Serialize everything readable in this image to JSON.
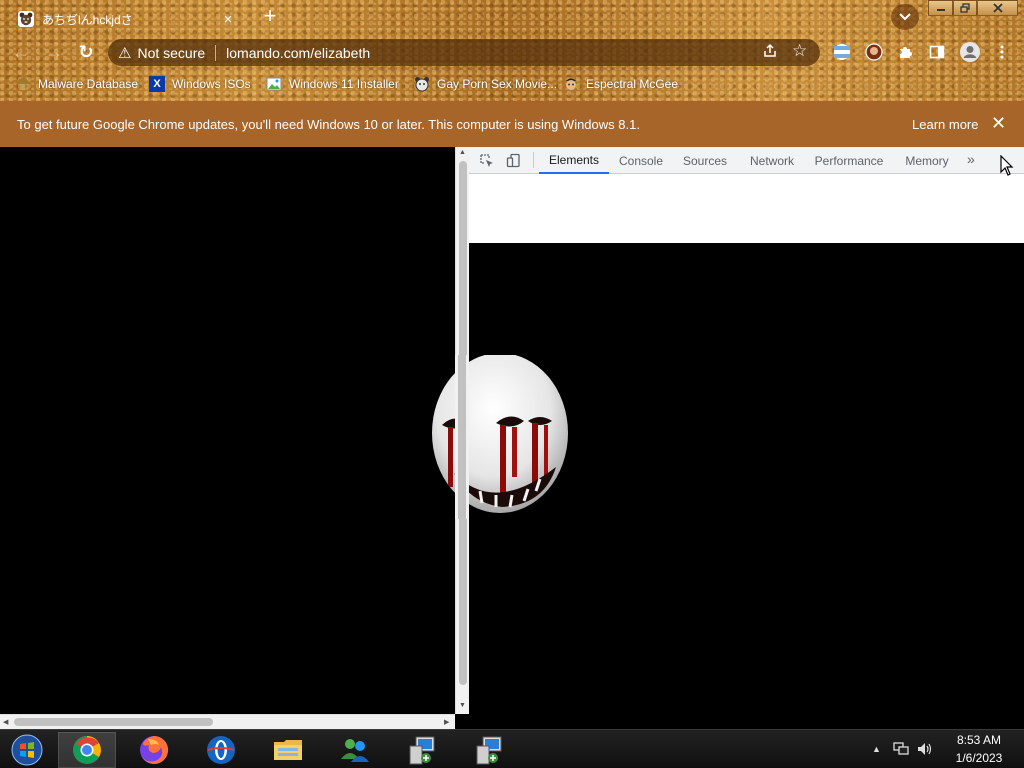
{
  "browser": {
    "tab": {
      "favicon": "bear-face-icon",
      "title": "あちぢlんhckjdさ",
      "close": "×"
    },
    "new_tab": "+",
    "tab_search": "⌄",
    "window_controls": [
      "minimize-icon",
      "restore-icon",
      "close-icon"
    ],
    "toolbar": {
      "back": "←",
      "forward": "→",
      "reload": "↻",
      "security_icon": "⚠",
      "security_label": "Not secure",
      "url": "lomando.com/elizabeth",
      "share_icon": "share-icon",
      "bookmark_star": "☆",
      "extensions": [
        "flag-icon",
        "profile-picture-icon",
        "puzzle-piece-icon",
        "side-panel-icon",
        "account-icon",
        "more-vert-icon"
      ]
    },
    "bookmarks": [
      {
        "label": "Malware Database",
        "icon": "mushroom-icon"
      },
      {
        "label": "Windows ISOs",
        "icon": "x-logo-icon"
      },
      {
        "label": "Windows 11 Installer",
        "icon": "image-icon"
      },
      {
        "label": "Gay Porn Sex Movie...",
        "icon": "bear-icon"
      },
      {
        "label": "Espectral McGee",
        "icon": "face-icon"
      }
    ]
  },
  "infobar": {
    "message": "To get future Google Chrome updates, you'll need Windows 10 or later. This computer is using Windows 8.1.",
    "action": "Learn more",
    "close": "✕"
  },
  "devtools": {
    "tools": [
      "inspect-element-icon",
      "device-toolbar-icon"
    ],
    "tabs": [
      "Elements",
      "Console",
      "Sources",
      "Network",
      "Performance",
      "Memory"
    ],
    "active_tab": "Elements",
    "more_tabs": "»"
  },
  "taskbar": {
    "apps": [
      {
        "name": "start-button",
        "icon": "windows-orb-icon"
      },
      {
        "name": "chrome",
        "icon": "chrome-icon",
        "active": true
      },
      {
        "name": "firefox",
        "icon": "firefox-icon"
      },
      {
        "name": "opera",
        "icon": "opera-icon"
      },
      {
        "name": "file-explorer",
        "icon": "folder-icon"
      },
      {
        "name": "messenger",
        "icon": "people-icon"
      },
      {
        "name": "remote-desktop-1",
        "icon": "computer-icon"
      },
      {
        "name": "remote-desktop-2",
        "icon": "computer-icon"
      }
    ],
    "tray": {
      "show_hidden": "▲",
      "network": "network-icon",
      "volume": "volume-icon"
    },
    "clock": {
      "time": "8:53 AM",
      "date": "1/6/2023"
    }
  }
}
